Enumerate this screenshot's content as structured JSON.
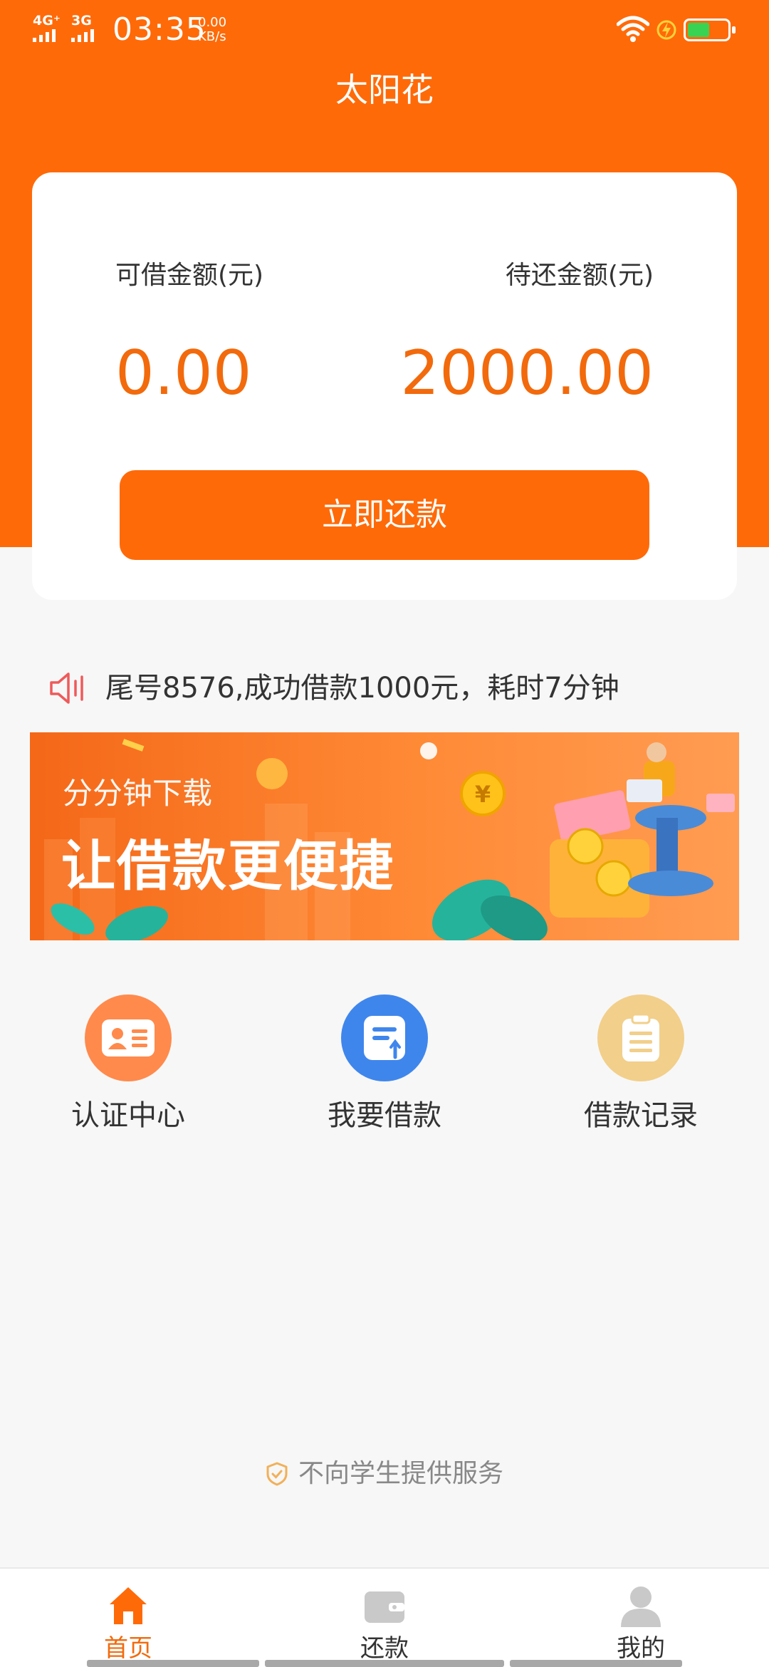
{
  "status_bar": {
    "network1": "4G⁺",
    "network2": "3G",
    "time": "03:35",
    "speed_value": "0.00",
    "speed_unit": "KB/s",
    "battery_level": 0.55,
    "battery_color": "#39d353"
  },
  "header": {
    "title": "太阳花"
  },
  "card": {
    "available_label": "可借金额(元)",
    "available_value": "0.00",
    "pending_label": "待还金额(元)",
    "pending_value": "2000.00",
    "repay_button": "立即还款"
  },
  "notice": {
    "icon": "speaker-icon",
    "text": "尾号8576,成功借款1000元，耗时7分钟"
  },
  "banner": {
    "subtitle": "分分钟下载",
    "headline": "让借款更便捷"
  },
  "quick_nav": [
    {
      "label": "认证中心",
      "icon": "id-card-icon",
      "color": "#ff8a4c"
    },
    {
      "label": "我要借款",
      "icon": "loan-form-icon",
      "color": "#3f86ec"
    },
    {
      "label": "借款记录",
      "icon": "clipboard-icon",
      "color": "#f2cf8a"
    }
  ],
  "footer_tip": {
    "icon": "shield-check-icon",
    "text": "不向学生提供服务"
  },
  "tabbar": [
    {
      "label": "首页",
      "icon": "home-icon",
      "active": true
    },
    {
      "label": "还款",
      "icon": "wallet-icon",
      "active": false
    },
    {
      "label": "我的",
      "icon": "user-icon",
      "active": false
    }
  ],
  "colors": {
    "brand": "#ff6a08",
    "amount": "#f26a0c",
    "background": "#f7f7f7"
  }
}
